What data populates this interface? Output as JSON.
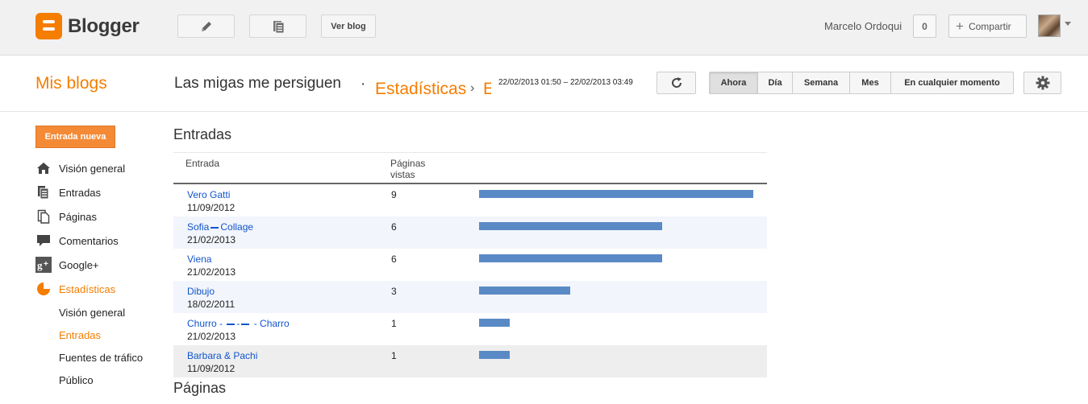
{
  "app": {
    "name": "Blogger"
  },
  "topbar": {
    "view_blog_label": "Ver blog",
    "user_name": "Marcelo Ordoqui",
    "notification_count": "0",
    "share_label": "Compartir"
  },
  "header": {
    "my_blogs": "Mis blogs",
    "blog_name": "Las migas me persiguen",
    "separator": "·",
    "crumb_stats": "Estadísticas",
    "crumb_arrow": "›",
    "crumb_cut": "E",
    "date_range": "22/02/2013 01:50 – 22/02/2013 03:49",
    "periods": [
      {
        "label": "Ahora",
        "active": true
      },
      {
        "label": "Día",
        "active": false
      },
      {
        "label": "Semana",
        "active": false
      },
      {
        "label": "Mes",
        "active": false
      },
      {
        "label": "En cualquier momento",
        "active": false
      }
    ]
  },
  "sidebar": {
    "new_post": "Entrada nueva",
    "items": [
      {
        "label": "Visión general",
        "icon": "home-icon"
      },
      {
        "label": "Entradas",
        "icon": "posts-icon"
      },
      {
        "label": "Páginas",
        "icon": "pages-icon"
      },
      {
        "label": "Comentarios",
        "icon": "comments-icon"
      },
      {
        "label": "Google+",
        "icon": "google-plus-icon"
      },
      {
        "label": "Estadísticas",
        "icon": "stats-icon",
        "active": true
      }
    ],
    "sub_items": [
      {
        "label": "Visión general",
        "active": false
      },
      {
        "label": "Entradas",
        "active": true
      },
      {
        "label": "Fuentes de tráfico",
        "active": false
      },
      {
        "label": "Público",
        "active": false
      }
    ]
  },
  "main": {
    "section_title": "Entradas",
    "next_section_title": "Páginas",
    "columns": {
      "post": "Entrada",
      "views_line1": "Páginas",
      "views_line2": "vistas"
    },
    "rows": [
      {
        "title": "Vero Gatti",
        "date": "11/09/2012",
        "views": 9
      },
      {
        "title_parts": [
          "Sofia",
          "Collage"
        ],
        "date": "21/02/2013",
        "views": 6
      },
      {
        "title": "Viena",
        "date": "21/02/2013",
        "views": 6
      },
      {
        "title": "Dibujo",
        "date": "18/02/2011",
        "views": 3
      },
      {
        "title_parts": [
          "Churro -",
          "-",
          "- Charro"
        ],
        "date": "21/02/2013",
        "views": 1
      },
      {
        "title": "Barbara & Pachi",
        "date": "11/09/2012",
        "views": 1
      }
    ]
  },
  "colors": {
    "accent": "#f57d00",
    "bar": "#5a8ac6",
    "link": "#1155cc"
  }
}
